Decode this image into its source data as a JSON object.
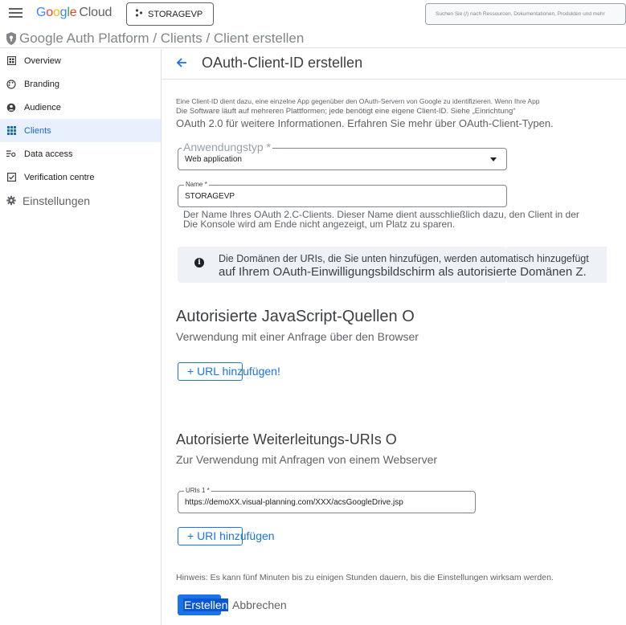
{
  "topbar": {
    "logo_letters": [
      "G",
      "o",
      "o",
      "g",
      "l",
      "e"
    ],
    "logo_suffix": "Cloud",
    "project_name": "STORAGEVP",
    "search_placeholder": "Suchen Sie (/) nach Ressourcen, Dokumentationen, Produkten und mehr"
  },
  "breadcrumb": {
    "text": "Google Auth Platform / Clients / Client erstellen"
  },
  "sidebar": {
    "items": [
      {
        "label": "Overview",
        "icon": "dashboard-icon"
      },
      {
        "label": "Branding",
        "icon": "palette-icon"
      },
      {
        "label": "Audience",
        "icon": "person-icon"
      },
      {
        "label": "Clients",
        "icon": "grid-icon",
        "active": true
      },
      {
        "label": "Data access",
        "icon": "data-access-icon"
      },
      {
        "label": "Verification centre",
        "icon": "checkbox-icon"
      },
      {
        "label": "Einstellungen",
        "icon": "gear-icon"
      }
    ]
  },
  "header": {
    "title": "OAuth-Client-ID erstellen"
  },
  "intro": {
    "line1": "Eine Client-ID dient dazu, eine einzelne App gegenüber den OAuth-Servern von Google zu identifizieren. Wenn Ihre App",
    "line2": "Die Software läuft auf mehreren Plattformen; jede benötigt eine eigene Client-ID. Siehe „Einrichtung“",
    "line3": "OAuth 2.0 für weitere Informationen. Erfahren Sie mehr über OAuth-Client-Typen."
  },
  "app_type": {
    "label": "Anwendungstyp *",
    "value": "Web application"
  },
  "name_field": {
    "label": "Name *",
    "value": "STORAGEVP",
    "helper_line1": "Der Name Ihres OAuth 2.C-Clients. Dieser Name dient ausschließlich dazu, den Client in der",
    "helper_line2": "Die Konsole wird am Ende nicht angezeigt, um Platz zu sparen."
  },
  "info": {
    "line1": "Die Domänen der URIs, die Sie unten hinzufügen, werden automatisch hinzugefügt",
    "line2": "auf Ihrem OAuth-Einwilligungsbildschirm als autorisierte Domänen Z."
  },
  "js_origins": {
    "title": "Autorisierte JavaScript-Quellen O",
    "subtitle": "Verwendung mit einer Anfrage über den Browser",
    "add_label": "+ URL hinzufügen!"
  },
  "redirect_uris": {
    "title": "Autorisierte Weiterleitungs-URIs O",
    "subtitle": "Zur Verwendung mit Anfragen von einem Webserver",
    "field_label": "URIs 1 *",
    "field_value": "https://demoXX.visual-planning.com/XXX/acsGoogleDrive.jsp",
    "add_label": "+ URI hinzufügen"
  },
  "footer": {
    "hint": "Hinweis: Es kann fünf Minuten bis zu einigen Stunden dauern, bis die Einstellungen wirksam werden.",
    "create_label": "Erstellen",
    "cancel_label": "Abbrechen"
  },
  "colors": {
    "accent": "#1a73e8",
    "active_nav_bg": "#e8f0fe",
    "info_bg": "#eef1f5"
  }
}
